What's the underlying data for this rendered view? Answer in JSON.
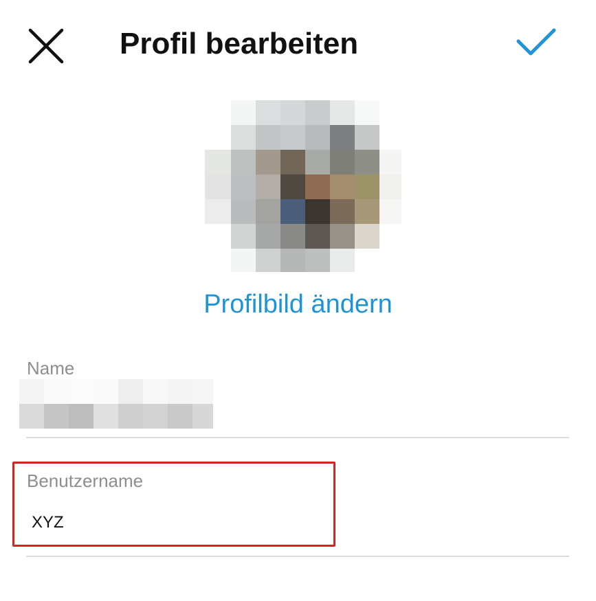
{
  "header": {
    "title": "Profil bearbeiten",
    "close_icon": "close-icon",
    "confirm_icon": "checkmark-icon"
  },
  "profile_picture": {
    "change_label": "Profilbild ändern",
    "accent_color": "#1f93d6"
  },
  "fields": {
    "name": {
      "label": "Name",
      "value": ""
    },
    "username": {
      "label": "Benutzername",
      "value": "XYZ"
    }
  },
  "annotation": {
    "highlight_color": "#d42323"
  }
}
